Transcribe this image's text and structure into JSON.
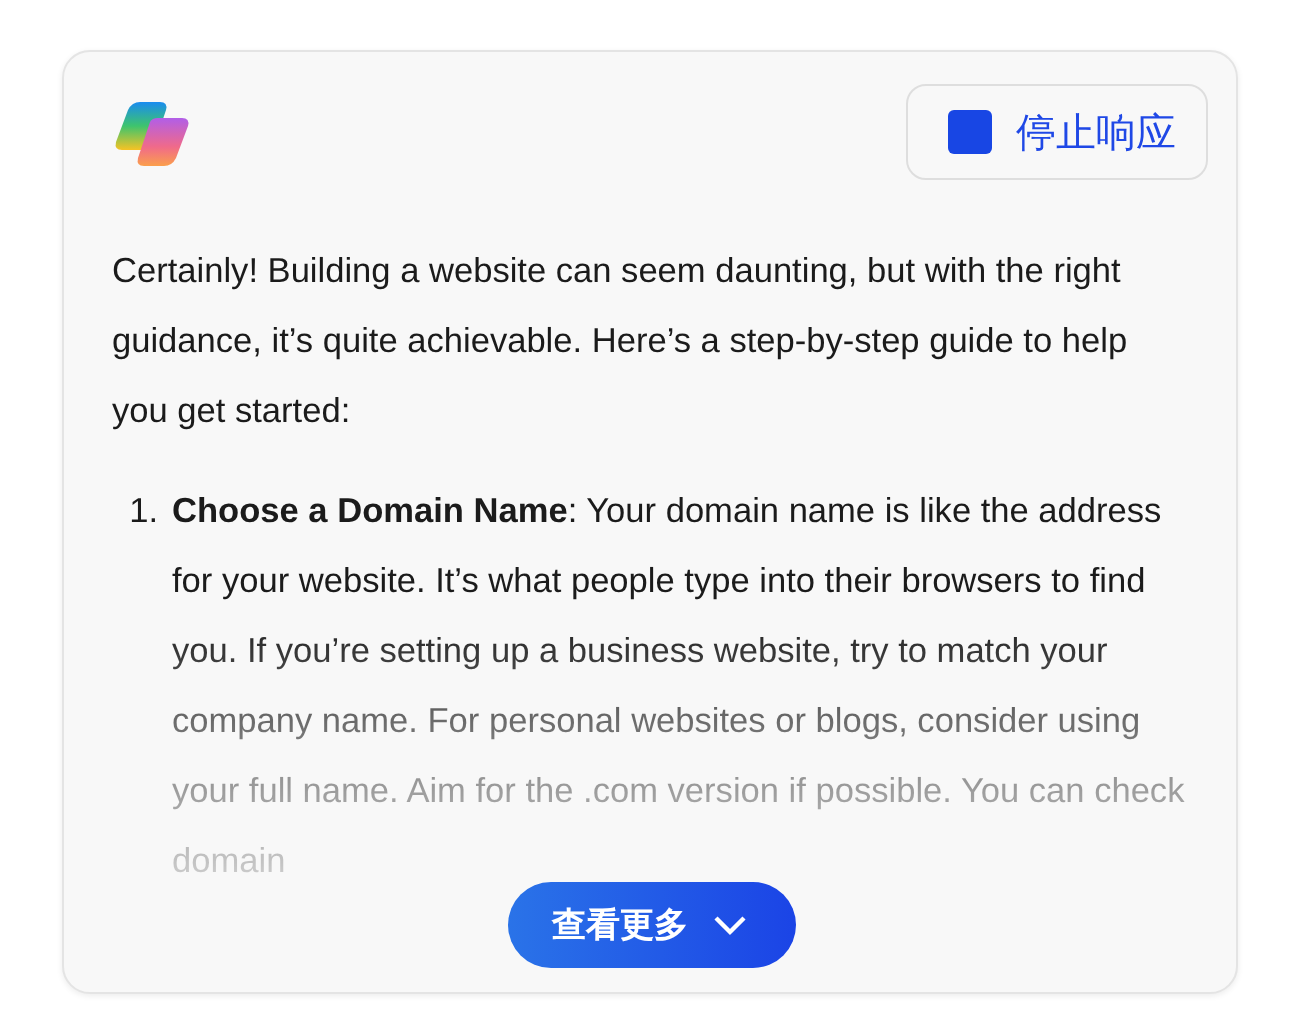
{
  "stop_button": {
    "label": "停止响应"
  },
  "message": {
    "intro": "Certainly! Building a website can seem daunting, but with the right guidance, it’s quite achievable. Here’s a step-by-step guide to help you get started:",
    "steps": [
      {
        "number": "1.",
        "text": "**Choose a Domain Name**: Your domain name is like the address for your website. It’s what people type into their browsers to find you. If you’re setting up a business website, try to match your company name. For personal websites or blogs, consider using your full name. Aim for the .com version if possible. You can check domain"
      }
    ]
  },
  "more_button": {
    "label": "查看更多"
  }
}
